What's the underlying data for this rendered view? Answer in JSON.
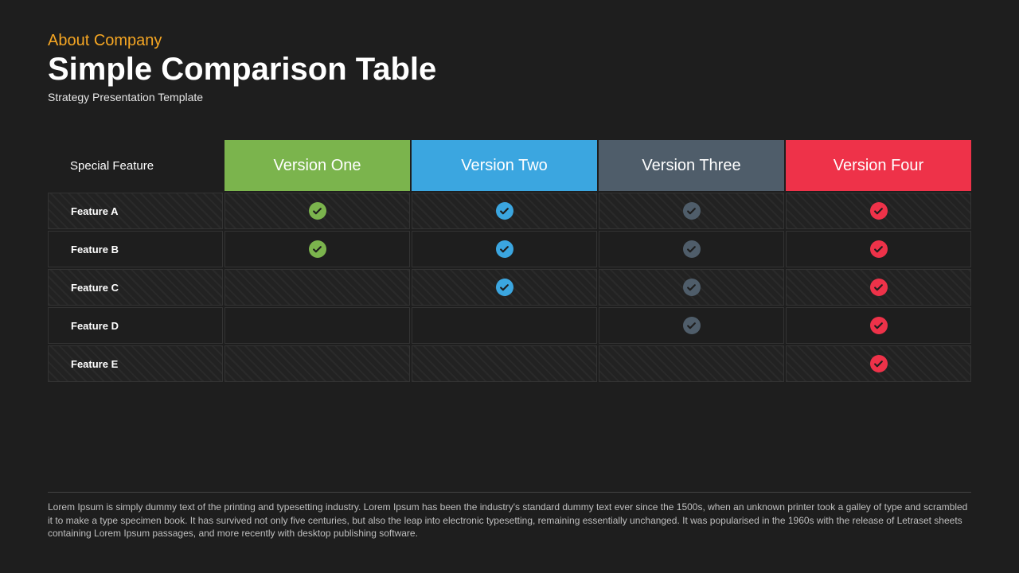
{
  "header": {
    "eyebrow": "About Company",
    "title": "Simple Comparison Table",
    "subtitle": "Strategy Presentation Template"
  },
  "table": {
    "feature_label": "Special Feature",
    "columns": [
      {
        "label": "Version One",
        "color": "green"
      },
      {
        "label": "Version Two",
        "color": "blue"
      },
      {
        "label": "Version Three",
        "color": "gray"
      },
      {
        "label": "Version Four",
        "color": "red"
      }
    ],
    "rows": [
      {
        "label": "Feature A",
        "stripe": true,
        "cells": [
          true,
          true,
          true,
          true
        ]
      },
      {
        "label": "Feature B",
        "stripe": false,
        "cells": [
          true,
          true,
          true,
          true
        ]
      },
      {
        "label": "Feature C",
        "stripe": true,
        "cells": [
          false,
          true,
          true,
          true
        ]
      },
      {
        "label": "Feature D",
        "stripe": false,
        "cells": [
          false,
          false,
          true,
          true
        ]
      },
      {
        "label": "Feature E",
        "stripe": true,
        "cells": [
          false,
          false,
          false,
          true
        ]
      }
    ]
  },
  "footer": {
    "text": "Lorem Ipsum is simply dummy text of the printing and typesetting industry. Lorem Ipsum has been the industry's standard dummy text ever since the 1500s, when an unknown printer took a galley of type and scrambled it to make a type specimen book. It has survived not only five centuries, but also the leap into electronic typesetting, remaining essentially unchanged. It was popularised in the 1960s with the release of Letraset sheets containing Lorem Ipsum passages, and more recently with desktop publishing software."
  },
  "colors": {
    "green": "#7bb44d",
    "blue": "#3ba6e0",
    "gray": "#4f5d6a",
    "red": "#ee3249"
  }
}
